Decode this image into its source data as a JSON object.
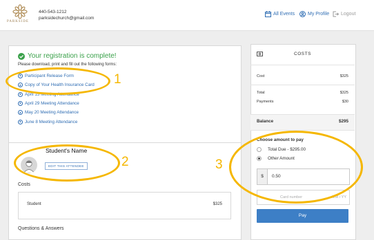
{
  "header": {
    "logo_text": "PARKSIDE",
    "phone": "440-543-1212",
    "email": "parksidechurch@gmail.com",
    "nav": [
      {
        "label": "All Events",
        "icon": "calendar-icon"
      },
      {
        "label": "My Profile",
        "icon": "user-circle-icon"
      },
      {
        "label": "Logout",
        "icon": "logout-icon"
      }
    ]
  },
  "registration": {
    "title": "Your registration is complete!",
    "subtitle": "Please download, print and fill out the following forms:",
    "forms": [
      "Participant Release Form",
      "Copy of Your Health Insurance Card",
      "April 15 Meeting Attendance",
      "April 29 Meeting Attendance",
      "May 20 Meeting Attendance",
      "June 8 Meeting Attendance"
    ]
  },
  "attendee": {
    "name": "Student's Name",
    "edit_label": "EDIT THIS ATTENDEE",
    "costs_label": "Costs",
    "cost_item": "Student",
    "cost_amount": "$325",
    "qa_label": "Questions & Answers"
  },
  "summary": {
    "title": "COSTS",
    "cost_label": "Cost",
    "cost_value": "$325",
    "total_label": "Total",
    "total_value": "$325",
    "payments_label": "Payments",
    "payments_value": "$30",
    "balance_label": "Balance",
    "balance_value": "$295"
  },
  "payment": {
    "choose_label": "Choose amount to pay",
    "option_total": "Total Due - $295.00",
    "option_other": "Other Amount",
    "selected": "Other Amount",
    "currency": "$",
    "amount": "0.50",
    "card_placeholder": "Card number",
    "expiry_placeholder": "MM / YY",
    "pay_label": "Pay"
  },
  "annotations": [
    "1",
    "2",
    "3"
  ],
  "colors": {
    "accent_blue": "#2f6db3",
    "success_green": "#3aa14a",
    "annotation_yellow": "#f5b700",
    "pay_button": "#3d7fc6"
  }
}
